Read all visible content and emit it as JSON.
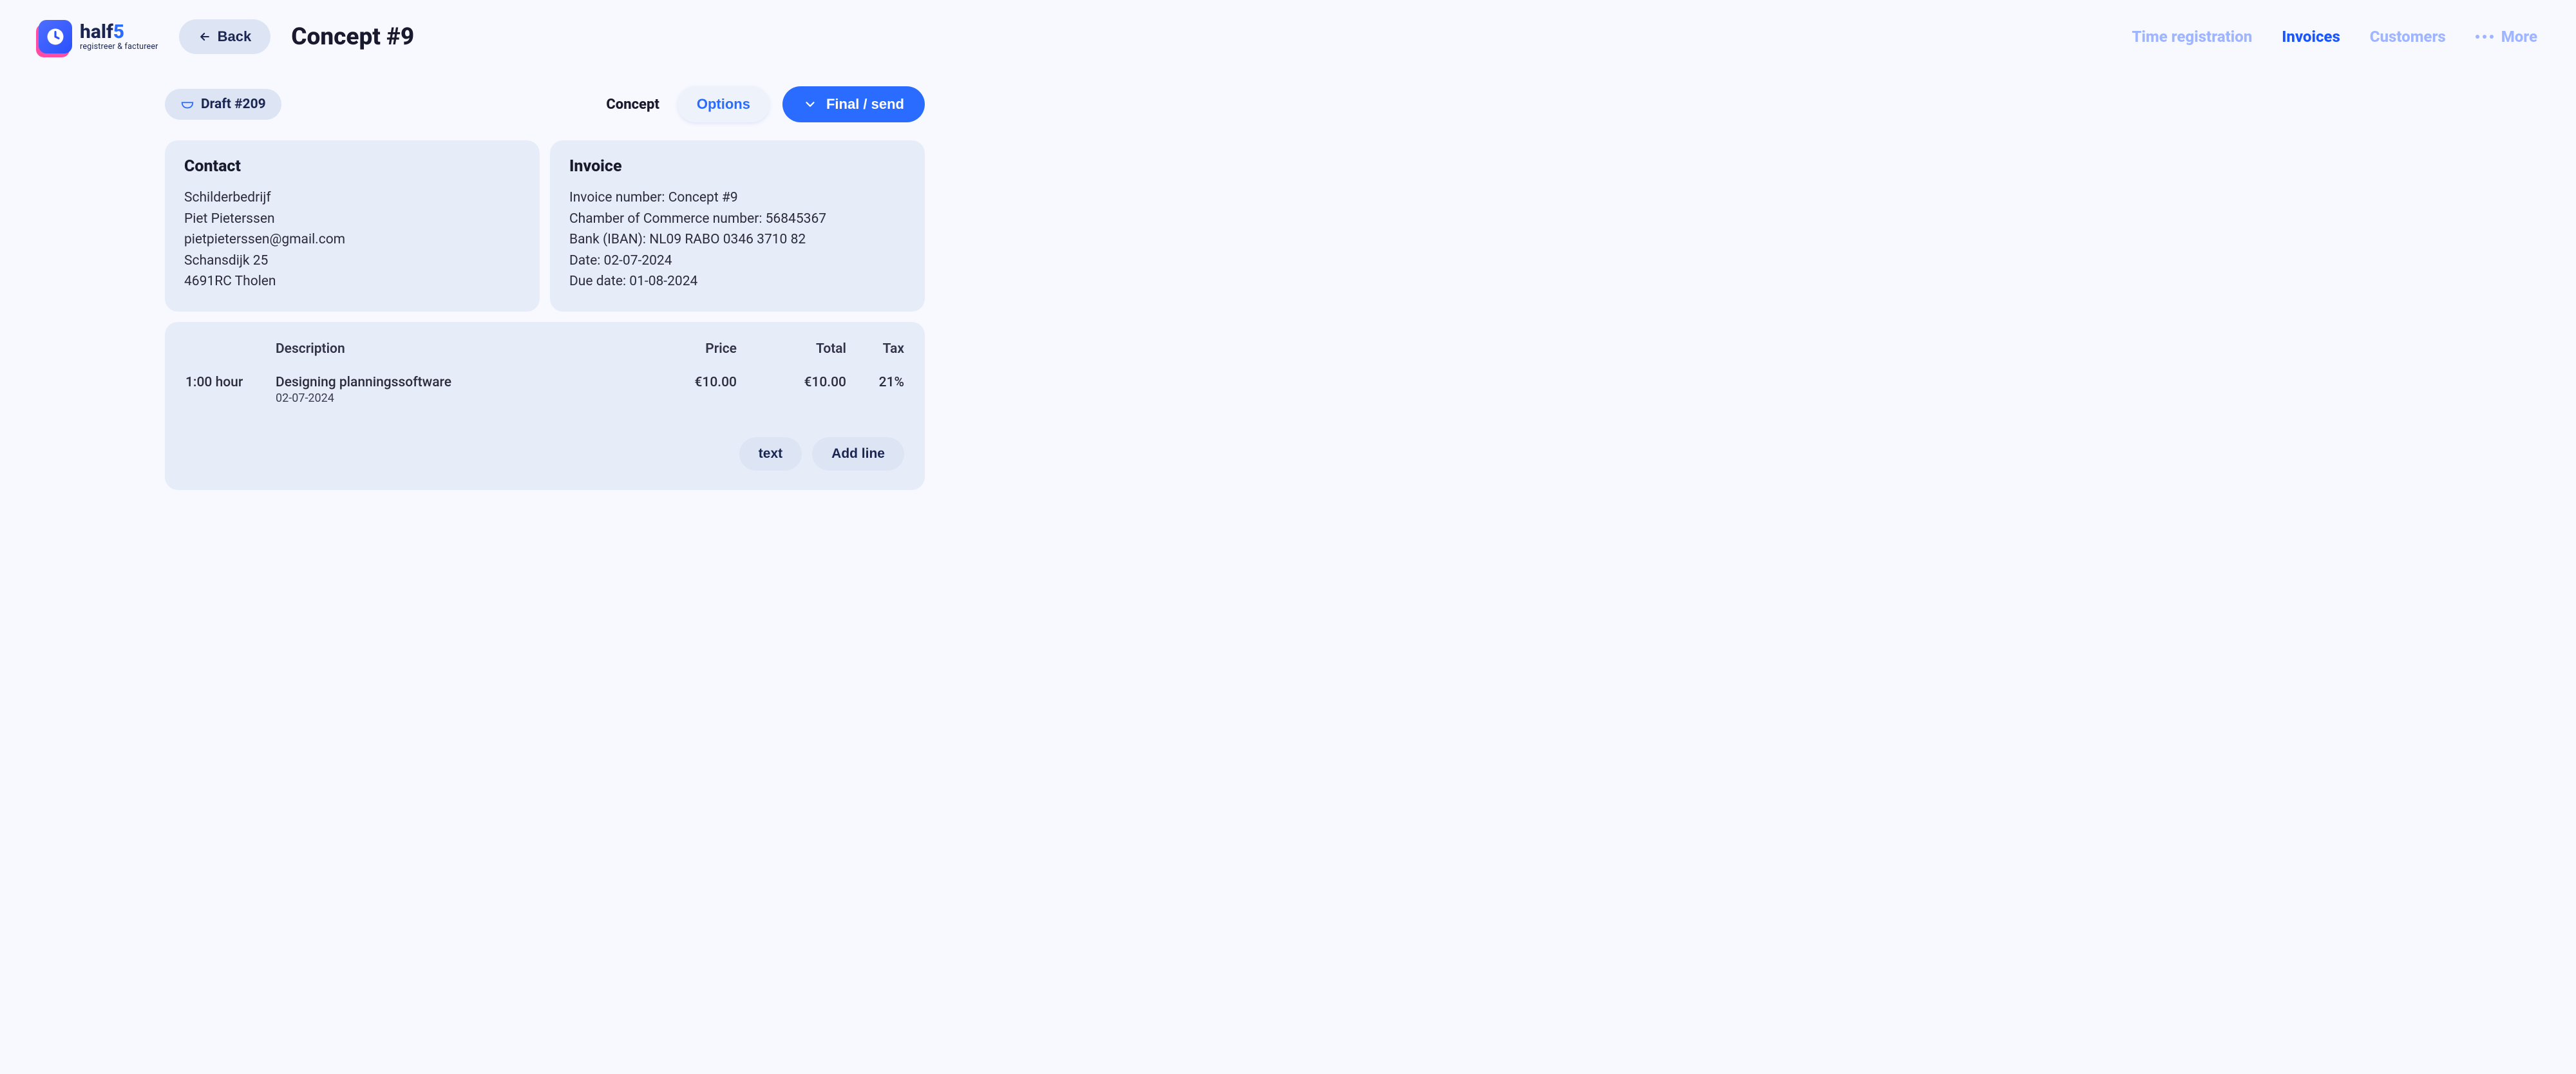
{
  "brand": {
    "name_part1": "half",
    "name_part2": "5",
    "tagline": "registreer & factureer"
  },
  "header": {
    "back_label": "Back",
    "page_title": "Concept #9"
  },
  "nav": {
    "time": "Time registration",
    "invoices": "Invoices",
    "customers": "Customers",
    "more": "More"
  },
  "actions": {
    "draft_chip": "Draft #209",
    "concept": "Concept",
    "options": "Options",
    "final": "Final / send"
  },
  "contact": {
    "heading": "Contact",
    "company": "Schilderbedrijf",
    "name": "Piet Pieterssen",
    "email": "pietpieterssen@gmail.com",
    "street": "Schansdijk 25",
    "city": "4691RC Tholen"
  },
  "invoice": {
    "heading": "Invoice",
    "number_label": "Invoice number:",
    "number_value": "Concept #9",
    "coc_label": "Chamber of Commerce number:",
    "coc_value": "56845367",
    "bank_label": "Bank (IBAN):",
    "bank_value": "NL09 RABO 0346 3710 82",
    "date_label": "Date:",
    "date_value": "02-07-2024",
    "due_label": "Due date:",
    "due_value": "01-08-2024"
  },
  "items": {
    "headers": {
      "description": "Description",
      "price": "Price",
      "total": "Total",
      "tax": "Tax"
    },
    "rows": [
      {
        "qty": "1:00 hour",
        "desc": "Designing planningssoftware",
        "date": "02-07-2024",
        "price": "€10.00",
        "total": "€10.00",
        "tax": "21%"
      }
    ],
    "text_btn": "text",
    "add_line_btn": "Add line"
  }
}
